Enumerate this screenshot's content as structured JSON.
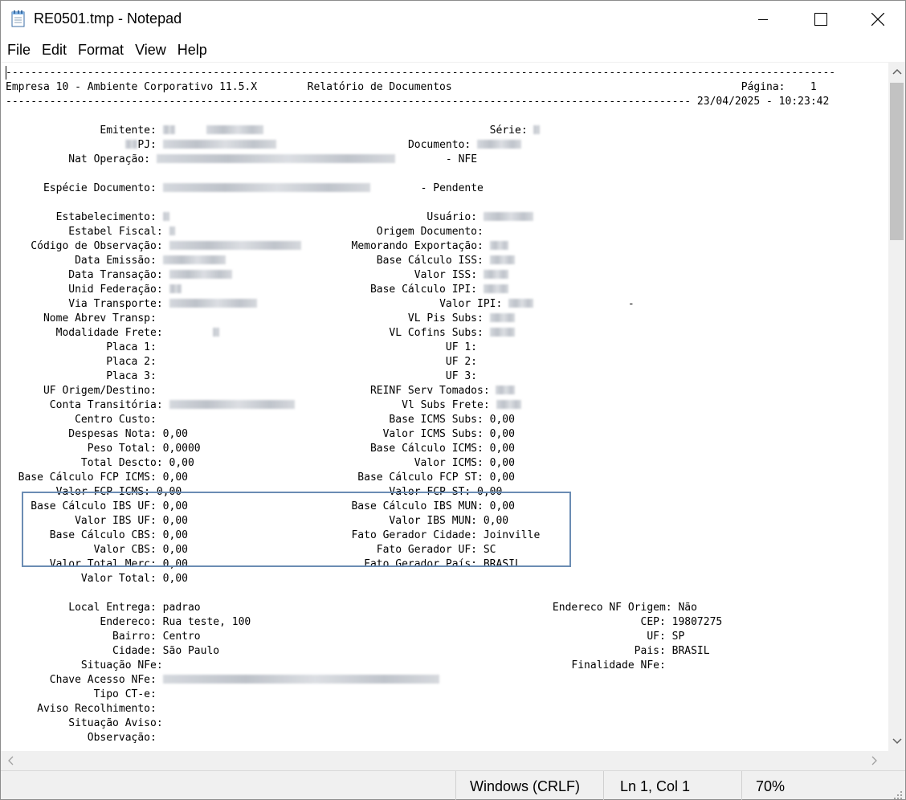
{
  "window": {
    "title": "RE0501.tmp - Notepad"
  },
  "menu": [
    "File",
    "Edit",
    "Format",
    "View",
    "Help"
  ],
  "document": {
    "lines": [
      [
        {
          "t": "------------------------------------------------------------------------------------------------------------------------------------"
        }
      ],
      [
        {
          "t": "Empresa 10 - Ambiente Corporativo 11.5.X        Relatório de Documentos                                              Página:    1"
        }
      ],
      [
        {
          "t": "------------------------------------------------------------------------------------------------------------- 23/04/2025 - 10:23:42"
        }
      ],
      [
        {
          "t": ""
        }
      ],
      [
        {
          "t": "               Emitente: "
        },
        {
          "b": 2
        },
        {
          "t": "     "
        },
        {
          "b": 9
        },
        {
          "t": "                                    Série: "
        },
        {
          "b": 1
        }
      ],
      [
        {
          "t": "                   "
        },
        {
          "b": 2
        },
        {
          "t": "PJ: "
        },
        {
          "b": 18
        },
        {
          "t": "                     Documento: "
        },
        {
          "b": 7
        }
      ],
      [
        {
          "t": "          Nat Operação: "
        },
        {
          "b": 38
        },
        {
          "t": "        - NFE"
        }
      ],
      [
        {
          "t": ""
        }
      ],
      [
        {
          "t": "      Espécie Documento: "
        },
        {
          "b": 33
        },
        {
          "t": "        - Pendente"
        }
      ],
      [
        {
          "t": ""
        }
      ],
      [
        {
          "t": "        Estabelecimento: "
        },
        {
          "b": 1
        },
        {
          "t": "                                         Usuário: "
        },
        {
          "b": 8
        }
      ],
      [
        {
          "t": "          Estabel Fiscal: "
        },
        {
          "b": 1
        },
        {
          "t": "                                Origem Documento:"
        }
      ],
      [
        {
          "t": "    Código de Observação: "
        },
        {
          "b": 21
        },
        {
          "t": "        Memorando Exportação: "
        },
        {
          "b": 3
        }
      ],
      [
        {
          "t": "           Data Emissão: "
        },
        {
          "b": 10
        },
        {
          "t": "                        Base Cálculo ISS: "
        },
        {
          "b": 4
        }
      ],
      [
        {
          "t": "          Data Transação: "
        },
        {
          "b": 10
        },
        {
          "t": "                             Valor ISS: "
        },
        {
          "b": 4
        }
      ],
      [
        {
          "t": "          Unid Federação: "
        },
        {
          "b": 2
        },
        {
          "t": "                              Base Cálculo IPI: "
        },
        {
          "b": 4
        }
      ],
      [
        {
          "t": "          Via Transporte: "
        },
        {
          "b": 14
        },
        {
          "t": "                             Valor IPI: "
        },
        {
          "b": 4
        },
        {
          "t": "               -"
        }
      ],
      [
        {
          "t": "      Nome Abrev Transp:                                        VL Pis Subs: "
        },
        {
          "b": 4
        }
      ],
      [
        {
          "t": "        Modalidade Frete:        "
        },
        {
          "b": 1
        },
        {
          "t": "                           VL Cofins Subs: "
        },
        {
          "b": 4
        }
      ],
      [
        {
          "t": "                Placa 1:                                              UF 1:"
        }
      ],
      [
        {
          "t": "                Placa 2:                                              UF 2:"
        }
      ],
      [
        {
          "t": "                Placa 3:                                              UF 3:"
        }
      ],
      [
        {
          "t": "      UF Origem/Destino:                                  REINF Serv Tomados: "
        },
        {
          "b": 3
        }
      ],
      [
        {
          "t": "       Conta Transitória: "
        },
        {
          "b": 20
        },
        {
          "t": "                 Vl Subs Frete: "
        },
        {
          "b": 4
        }
      ],
      [
        {
          "t": "           Centro Custo:                                     Base ICMS Subs: 0,00"
        }
      ],
      [
        {
          "t": "          Despesas Nota: 0,00                               Valor ICMS Subs: 0,00"
        }
      ],
      [
        {
          "t": "             Peso Total: 0,0000                           Base Cálculo ICMS: 0,00"
        }
      ],
      [
        {
          "t": "            Total Descto: 0,00                                   Valor ICMS: 0,00"
        }
      ],
      [
        {
          "t": "  Base Cálculo FCP ICMS: 0,00                           Base Cálculo FCP ST: 0,00"
        }
      ],
      [
        {
          "t": "        Valor FCP ICMS: 0,00                                 Valor FCP ST: 0,00"
        }
      ],
      [
        {
          "t": "    Base Cálculo IBS UF: 0,00                          Base Cálculo IBS MUN: 0,00"
        }
      ],
      [
        {
          "t": "           Valor IBS UF: 0,00                                Valor IBS MUN: 0,00"
        }
      ],
      [
        {
          "t": "       Base Cálculo CBS: 0,00                          Fato Gerador Cidade: Joinville"
        }
      ],
      [
        {
          "t": "              Valor CBS: 0,00                              Fato Gerador UF: SC"
        }
      ],
      [
        {
          "t": "       Valor Total Merc: 0,00                            Fato Gerador País: BRASIL"
        }
      ],
      [
        {
          "t": "            Valor Total: 0,00"
        }
      ],
      [
        {
          "t": ""
        }
      ],
      [
        {
          "t": "          Local Entrega: padrao                                                        Endereco NF Origem: Não"
        }
      ],
      [
        {
          "t": "               Endereco: Rua teste, 100                                                              CEP: 19807275"
        }
      ],
      [
        {
          "t": "                 Bairro: Centro                                                                       UF: SP"
        }
      ],
      [
        {
          "t": "                 Cidade: São Paulo                                                                  Pais: BRASIL"
        }
      ],
      [
        {
          "t": "            Situação NFe:                                                                 Finalidade NFe:"
        }
      ],
      [
        {
          "t": "       Chave Acesso NFe: "
        },
        {
          "b": 44
        }
      ],
      [
        {
          "t": "              Tipo CT-e:"
        }
      ],
      [
        {
          "t": "     Aviso Recolhimento:"
        }
      ],
      [
        {
          "t": "          Situação Aviso:"
        }
      ],
      [
        {
          "t": "             Observação:"
        }
      ]
    ]
  },
  "status": {
    "line_ending": "Windows (CRLF)",
    "position": "Ln 1, Col 1",
    "zoom": "70%"
  },
  "icons": {
    "app": "notepad-icon",
    "minimize": "minimize-icon",
    "maximize": "maximize-icon",
    "close": "close-icon"
  }
}
